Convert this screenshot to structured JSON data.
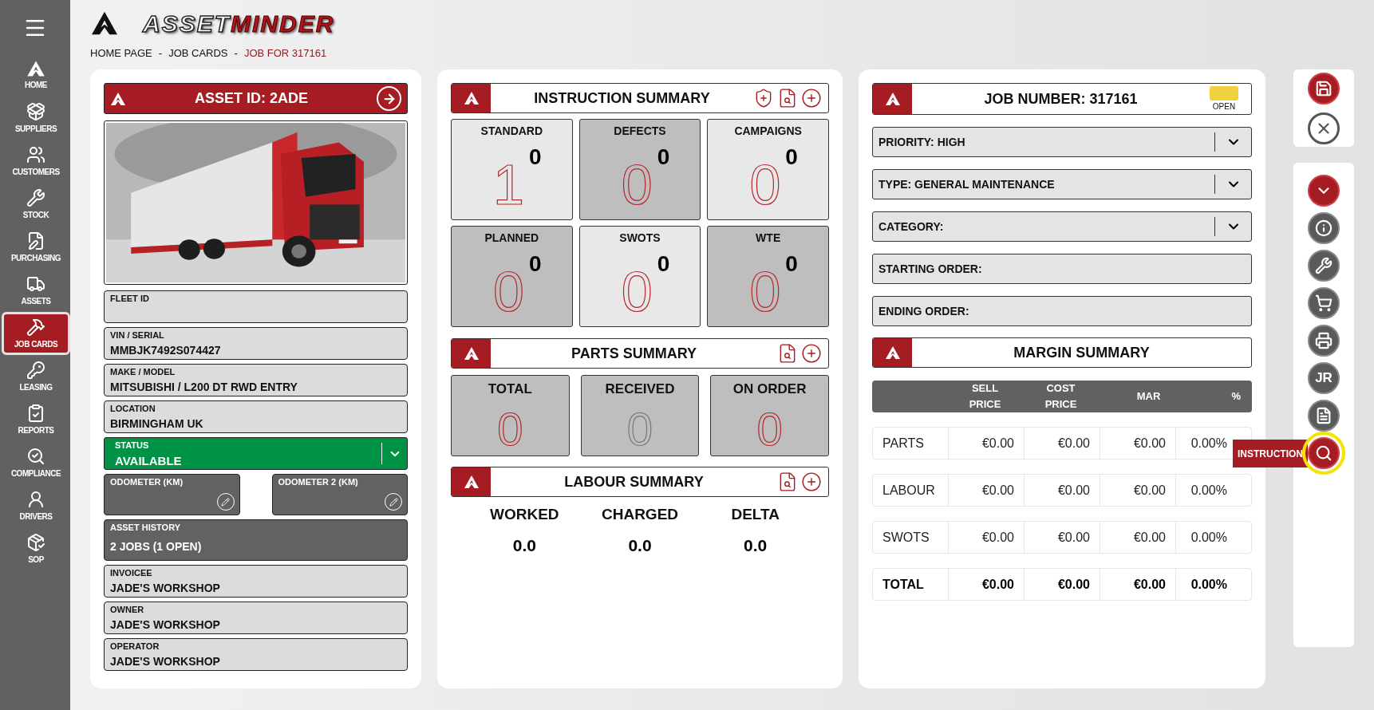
{
  "sidebar": {
    "items": [
      {
        "label": "HOME",
        "selected": false
      },
      {
        "label": "SUPPLIERS",
        "selected": false
      },
      {
        "label": "CUSTOMERS",
        "selected": false
      },
      {
        "label": "STOCK",
        "selected": false
      },
      {
        "label": "PURCHASING",
        "selected": false
      },
      {
        "label": "ASSETS",
        "selected": false
      },
      {
        "label": "JOB CARDS",
        "selected": true
      },
      {
        "label": "LEASING",
        "selected": false
      },
      {
        "label": "REPORTS",
        "selected": false
      },
      {
        "label": "COMPLIANCE",
        "selected": false
      },
      {
        "label": "DRIVERS",
        "selected": false
      },
      {
        "label": "SOP",
        "selected": false
      }
    ]
  },
  "logo": {
    "part_1": "ASSET",
    "part_2": "MINDER"
  },
  "breadcrumb": [
    {
      "label": "HOME PAGE",
      "current": false
    },
    {
      "label": "JOB CARDS",
      "current": false
    },
    {
      "label": "JOB FOR 317161",
      "current": true
    }
  ],
  "breadcrumb_separator": "-",
  "asset": {
    "title": "ASSET ID: 2ADE",
    "fields": [
      {
        "kind": "light",
        "label": "FLEET ID"
      },
      {
        "kind": "light",
        "label": "VIN / SERIAL",
        "value": "MMBJK7492S074427"
      },
      {
        "kind": "light",
        "label": "MAKE / MODEL",
        "value": "MITSUBISHI / L200 DT RWD ENTRY"
      },
      {
        "kind": "light",
        "label": "LOCATION",
        "value": "BIRMINGHAM UK"
      },
      {
        "kind": "status",
        "label": "STATUS",
        "value": "AVAILABLE"
      },
      {
        "kind": "meter",
        "label": "ODOMETER (KM)"
      },
      {
        "kind": "meter",
        "label": "ODOMETER 2 (KM)"
      },
      {
        "kind": "dark",
        "label": "ASSET HISTORY",
        "value": "2 JOBS (1 OPEN)"
      },
      {
        "kind": "light",
        "label": "INVOICEE",
        "value": "JADE'S WORKSHOP"
      },
      {
        "kind": "light",
        "label": "OWNER",
        "value": "JADE'S WORKSHOP"
      },
      {
        "kind": "light",
        "label": "OPERATOR",
        "value": "JADE'S WORKSHOP"
      }
    ]
  },
  "instruction_summary": {
    "title": "INSTRUCTION SUMMARY",
    "tiles": [
      {
        "label": "STANDARD",
        "count": "1",
        "badge": "0",
        "shaded": false
      },
      {
        "label": "DEFECTS",
        "count": "0",
        "badge": "0",
        "shaded": true
      },
      {
        "label": "CAMPAIGNS",
        "count": "0",
        "badge": "0",
        "shaded": false
      },
      {
        "label": "PLANNED",
        "count": "0",
        "badge": "0",
        "shaded": true
      },
      {
        "label": "SWOTS",
        "count": "0",
        "badge": "0",
        "shaded": false
      },
      {
        "label": "WTE",
        "count": "0",
        "badge": "0",
        "shaded": true
      }
    ]
  },
  "parts_summary": {
    "title": "PARTS SUMMARY",
    "tiles": [
      {
        "label": "TOTAL",
        "count": "0",
        "muted": false
      },
      {
        "label": "RECEIVED",
        "count": "0",
        "muted": true
      },
      {
        "label": "ON ORDER",
        "count": "0",
        "muted": false
      }
    ]
  },
  "labour_summary": {
    "title": "LABOUR SUMMARY",
    "stats": [
      {
        "label": "WORKED",
        "value": "0.0"
      },
      {
        "label": "CHARGED",
        "value": "0.0"
      },
      {
        "label": "DELTA",
        "value": "0.0"
      }
    ]
  },
  "job": {
    "title": "JOB NUMBER: 317161",
    "status": {
      "label": "OPEN",
      "color": "#f0d03c"
    },
    "fields": [
      {
        "label": "PRIORITY: HIGH",
        "dropdown": true
      },
      {
        "label": "TYPE: GENERAL MAINTENANCE",
        "dropdown": true
      },
      {
        "label": "CATEGORY:",
        "dropdown": true
      },
      {
        "label": "STARTING ORDER:",
        "dropdown": false
      },
      {
        "label": "ENDING ORDER:",
        "dropdown": false
      }
    ]
  },
  "margin_summary": {
    "title": "MARGIN SUMMARY",
    "columns": [
      "",
      "SELL PRICE",
      "COST PRICE",
      "MAR",
      "%"
    ],
    "rows": [
      {
        "kind": "line",
        "cells": [
          "PARTS",
          "€0.00",
          "€0.00",
          "€0.00",
          "0.00%"
        ]
      },
      {
        "kind": "line",
        "cells": [
          "LABOUR",
          "€0.00",
          "€0.00",
          "€0.00",
          "0.00%"
        ]
      },
      {
        "kind": "line",
        "cells": [
          "SWOTS",
          "€0.00",
          "€0.00",
          "€0.00",
          "0.00%"
        ]
      },
      {
        "kind": "total",
        "cells": [
          "TOTAL",
          "€0.00",
          "€0.00",
          "€0.00",
          "0.00%"
        ]
      }
    ]
  },
  "toolbar_top": [
    {
      "kind": "save",
      "highlighted": false
    },
    {
      "kind": "close",
      "highlighted": false
    }
  ],
  "toolbar": [
    {
      "kind": "collapse",
      "highlighted": false
    },
    {
      "kind": "info",
      "highlighted": false
    },
    {
      "kind": "tools",
      "highlighted": false
    },
    {
      "kind": "cart",
      "highlighted": false
    },
    {
      "kind": "print",
      "highlighted": false
    },
    {
      "kind": "jr",
      "text": "JR",
      "highlighted": false
    },
    {
      "kind": "document",
      "highlighted": false
    },
    {
      "kind": "search",
      "highlighted": true,
      "tooltip": "INSTRUCTION"
    }
  ]
}
